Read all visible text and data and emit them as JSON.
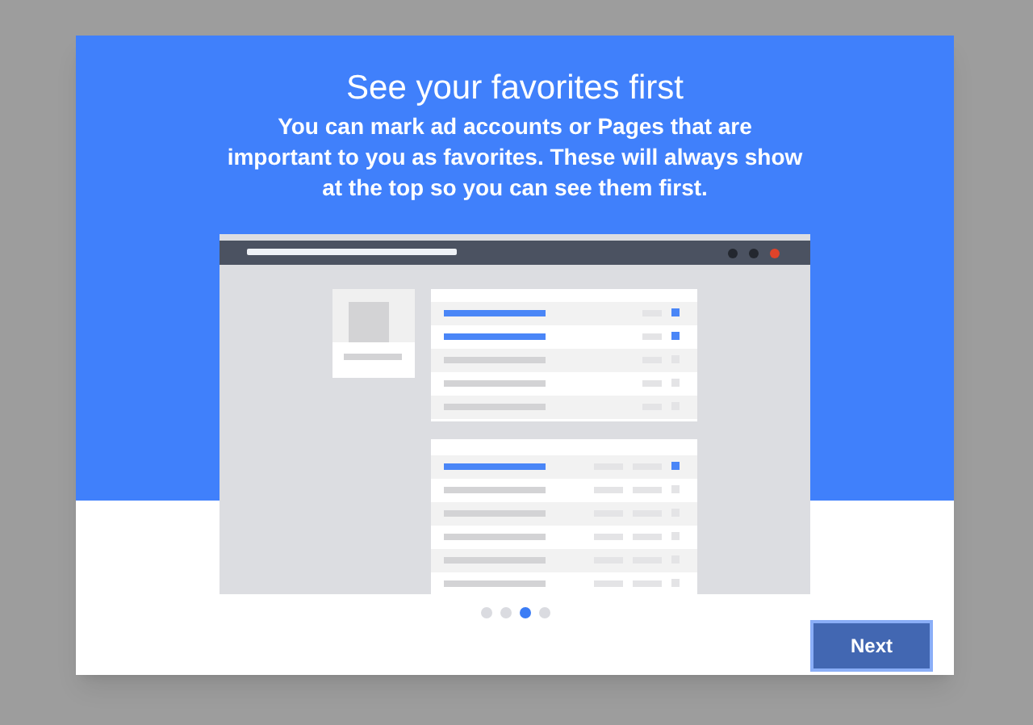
{
  "dialog": {
    "title": "See your favorites first",
    "description": "You can mark ad accounts or Pages that are important to you as favorites. These will always show at the top so you can see them first.",
    "steps": [
      {
        "selected": false
      },
      {
        "selected": false
      },
      {
        "selected": true
      },
      {
        "selected": false
      }
    ],
    "buttons": [
      {
        "label": "Next"
      }
    ]
  }
}
